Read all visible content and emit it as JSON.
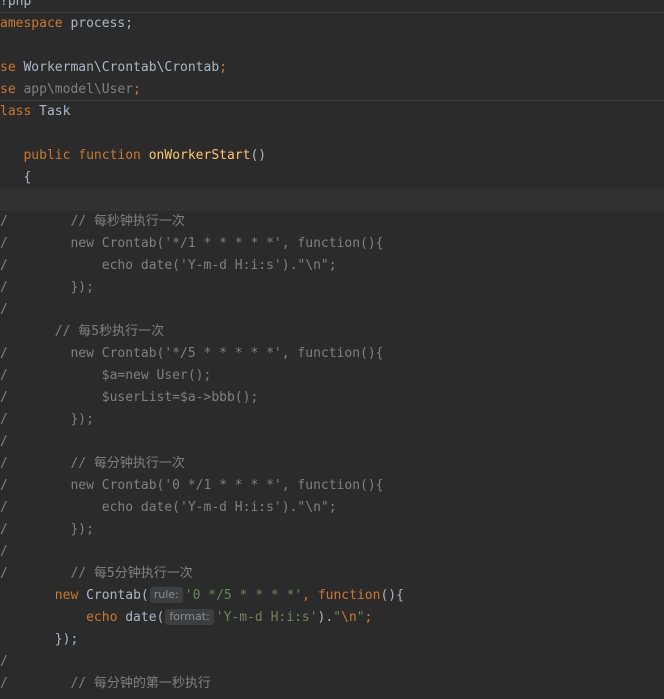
{
  "editor": {
    "lines": [
      {
        "gutter": "",
        "segments": [
          {
            "c": "plain",
            "t": "?php"
          }
        ]
      },
      {
        "gutter": "",
        "segments": [
          {
            "c": "kw",
            "t": "amespace"
          },
          {
            "c": "plain",
            "t": " process;"
          }
        ]
      },
      {
        "gutter": "",
        "segments": []
      },
      {
        "gutter": "",
        "segments": [
          {
            "c": "kw",
            "t": "se"
          },
          {
            "c": "plain",
            "t": " Workerman\\Crontab\\Crontab"
          },
          {
            "c": "kw",
            "t": ";"
          }
        ]
      },
      {
        "gutter": "",
        "segments": [
          {
            "c": "kw",
            "t": "se"
          },
          {
            "c": "dim",
            "t": " app\\model\\User"
          },
          {
            "c": "kw",
            "t": ";"
          }
        ]
      },
      {
        "gutter": "",
        "segments": [
          {
            "c": "kw",
            "t": "lass"
          },
          {
            "c": "plain",
            "t": " Task"
          }
        ]
      },
      {
        "gutter": "",
        "segments": []
      },
      {
        "gutter": "",
        "segments": [
          {
            "c": "plain",
            "t": "   "
          },
          {
            "c": "kw",
            "t": "public function"
          },
          {
            "c": "plain",
            "t": " "
          },
          {
            "c": "fn",
            "t": "onWorkerStart"
          },
          {
            "c": "plain",
            "t": "()"
          }
        ]
      },
      {
        "gutter": "",
        "segments": [
          {
            "c": "plain",
            "t": "   {"
          }
        ]
      },
      {
        "gutter": "",
        "segments": []
      },
      {
        "gutter": "/",
        "segments": [
          {
            "c": "cm",
            "t": "         // 每秒钟执行一次"
          }
        ]
      },
      {
        "gutter": "/",
        "segments": [
          {
            "c": "cm",
            "t": "         new Crontab('*/1 * * * * *', function(){"
          }
        ]
      },
      {
        "gutter": "/",
        "segments": [
          {
            "c": "cm",
            "t": "             echo date('Y-m-d H:i:s').\"\\n\";"
          }
        ]
      },
      {
        "gutter": "/",
        "segments": [
          {
            "c": "cm",
            "t": "         });"
          }
        ]
      },
      {
        "gutter": "/",
        "segments": []
      },
      {
        "gutter": "",
        "segments": [
          {
            "c": "cm",
            "t": "       // 每5秒执行一次"
          }
        ]
      },
      {
        "gutter": "/",
        "segments": [
          {
            "c": "cm",
            "t": "         new Crontab('*/5 * * * * *', function(){"
          }
        ]
      },
      {
        "gutter": "/",
        "segments": [
          {
            "c": "cm",
            "t": "             $a=new User();"
          }
        ]
      },
      {
        "gutter": "/",
        "segments": [
          {
            "c": "cm",
            "t": "             $userList=$a->bbb();"
          }
        ]
      },
      {
        "gutter": "/",
        "segments": [
          {
            "c": "cm",
            "t": "         });"
          }
        ]
      },
      {
        "gutter": "/",
        "segments": []
      },
      {
        "gutter": "/",
        "segments": [
          {
            "c": "cm",
            "t": "         // 每分钟执行一次"
          }
        ]
      },
      {
        "gutter": "/",
        "segments": [
          {
            "c": "cm",
            "t": "         new Crontab('0 */1 * * * *', function(){"
          }
        ]
      },
      {
        "gutter": "/",
        "segments": [
          {
            "c": "cm",
            "t": "             echo date('Y-m-d H:i:s').\"\\n\";"
          }
        ]
      },
      {
        "gutter": "/",
        "segments": [
          {
            "c": "cm",
            "t": "         });"
          }
        ]
      },
      {
        "gutter": "/",
        "segments": []
      },
      {
        "gutter": "/",
        "segments": [
          {
            "c": "cm",
            "t": "         // 每5分钟执行一次"
          }
        ]
      },
      {
        "gutter": "",
        "segments": [
          {
            "c": "plain",
            "t": "       "
          },
          {
            "c": "kw",
            "t": "new"
          },
          {
            "c": "plain",
            "t": " Crontab("
          },
          {
            "c": "hint",
            "t": "rule:"
          },
          {
            "c": "str",
            "t": "'0 */5 * * * *'"
          },
          {
            "c": "kw",
            "t": ","
          },
          {
            "c": "plain",
            "t": " "
          },
          {
            "c": "kw",
            "t": "function"
          },
          {
            "c": "plain",
            "t": "(){"
          }
        ]
      },
      {
        "gutter": "",
        "segments": [
          {
            "c": "plain",
            "t": "           "
          },
          {
            "c": "kw",
            "t": "echo"
          },
          {
            "c": "plain",
            "t": " date("
          },
          {
            "c": "hint",
            "t": "format:"
          },
          {
            "c": "str",
            "t": "'Y-m-d H:i:s'"
          },
          {
            "c": "plain",
            "t": ")."
          },
          {
            "c": "str",
            "t": "\""
          },
          {
            "c": "esc",
            "t": "\\n"
          },
          {
            "c": "str",
            "t": "\""
          },
          {
            "c": "kw",
            "t": ";"
          }
        ]
      },
      {
        "gutter": "",
        "segments": [
          {
            "c": "plain",
            "t": "       });"
          }
        ]
      },
      {
        "gutter": "/",
        "segments": []
      },
      {
        "gutter": "/",
        "segments": [
          {
            "c": "cm",
            "t": "         // 每分钟的第一秒执行"
          }
        ]
      }
    ]
  }
}
